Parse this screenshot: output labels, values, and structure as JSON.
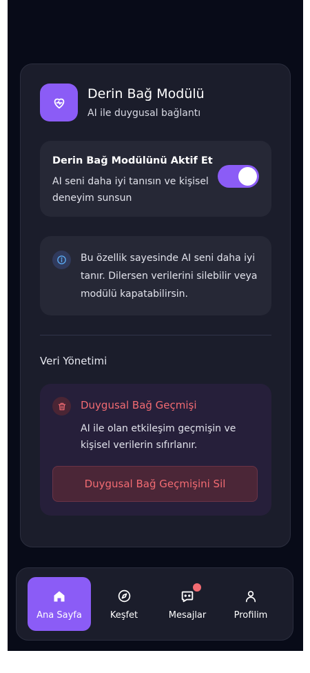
{
  "module": {
    "title": "Derin Bağ Modülü",
    "subtitle": "AI ile duygusal bağlantı",
    "icon": "heart-pulse-icon"
  },
  "toggle": {
    "title": "Derin Bağ Modülünü Aktif Et",
    "description": "AI seni daha iyi tanısın ve kişisel deneyim sunsun",
    "enabled": true
  },
  "info": {
    "text": "Bu özellik sayesinde AI seni daha iyi tanır. Dilersen verilerini silebilir veya modülü kapatabilirsin.",
    "icon": "info-icon"
  },
  "data_management": {
    "section_title": "Veri Yönetimi",
    "history_title": "Duygusal Bağ Geçmişi",
    "history_description": "AI ile olan etkileşim geçmişin ve kişisel verilerin sıfırlanır.",
    "delete_button": "Duygusal Bağ Geçmişini Sil",
    "icon": "trash-icon"
  },
  "nav": {
    "items": [
      {
        "label": "Ana Sayfa",
        "icon": "home-icon",
        "active": true
      },
      {
        "label": "Keşfet",
        "icon": "compass-icon",
        "active": false
      },
      {
        "label": "Mesajlar",
        "icon": "chat-icon",
        "active": false,
        "notification": true
      },
      {
        "label": "Profilim",
        "icon": "user-icon",
        "active": false
      }
    ]
  },
  "colors": {
    "accent": "#8b5cf6",
    "danger": "#f26b72",
    "background": "#080b18",
    "card": "#1b1d2b"
  }
}
